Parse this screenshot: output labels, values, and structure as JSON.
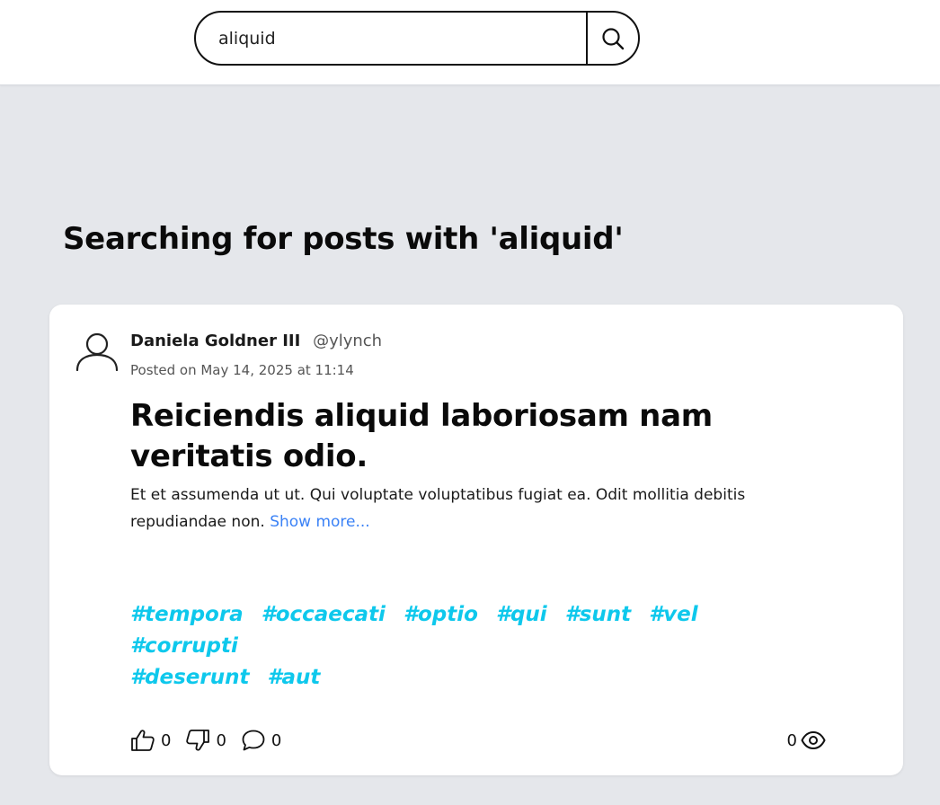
{
  "search": {
    "value": "aliquid",
    "icon": "search-icon"
  },
  "page": {
    "heading": "Searching for posts with 'aliquid'"
  },
  "post": {
    "author_name": "Daniela Goldner III",
    "author_handle": "@ylynch",
    "posted_on": "Posted on May 14, 2025 at 11:14",
    "title": "Reiciendis aliquid laboriosam nam veritatis odio.",
    "excerpt": "Et et assumenda ut ut. Qui voluptate voluptatibus fugiat ea. Odit mollitia debitis repudiandae non.",
    "show_more": "Show more...",
    "tags": [
      "#tempora",
      "#occaecati",
      "#optio",
      "#qui",
      "#sunt",
      "#vel",
      "#corrupti",
      "#deserunt",
      "#aut"
    ],
    "likes": "0",
    "dislikes": "0",
    "comments": "0",
    "views": "0"
  },
  "colors": {
    "background": "#e5e7eb",
    "card": "#ffffff",
    "link": "#3b82f6",
    "tag": "#0ec8ec"
  }
}
